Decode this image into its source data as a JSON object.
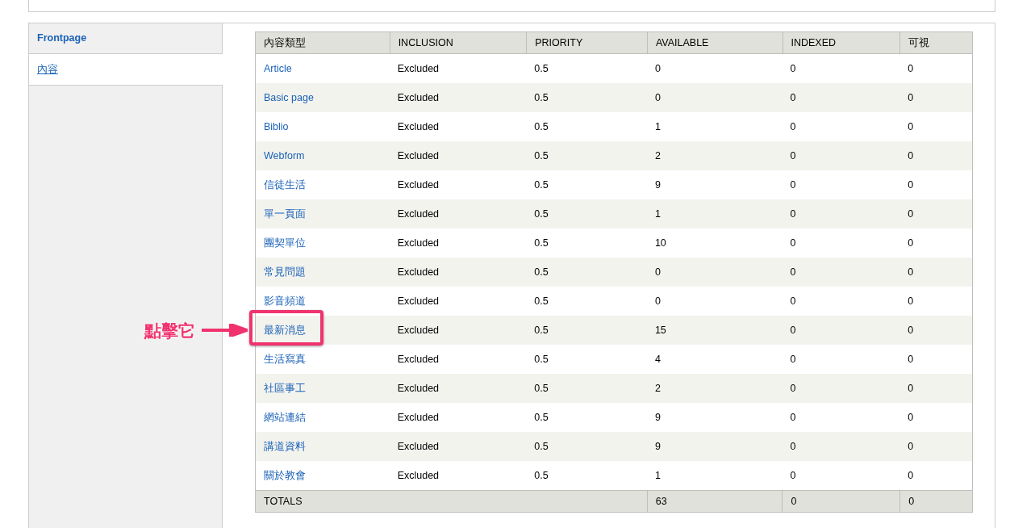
{
  "tabs": [
    {
      "label": "Frontpage",
      "selected": false
    },
    {
      "label": "內容",
      "selected": true
    }
  ],
  "table": {
    "columns": [
      "內容類型",
      "INCLUSION",
      "PRIORITY",
      "AVAILABLE",
      "INDEXED",
      "可視"
    ],
    "rows": [
      {
        "type": "Article",
        "inclusion": "Excluded",
        "priority": "0.5",
        "available": "0",
        "indexed": "0",
        "visible": "0",
        "highlighted": false
      },
      {
        "type": "Basic page",
        "inclusion": "Excluded",
        "priority": "0.5",
        "available": "0",
        "indexed": "0",
        "visible": "0",
        "highlighted": false
      },
      {
        "type": "Biblio",
        "inclusion": "Excluded",
        "priority": "0.5",
        "available": "1",
        "indexed": "0",
        "visible": "0",
        "highlighted": false
      },
      {
        "type": "Webform",
        "inclusion": "Excluded",
        "priority": "0.5",
        "available": "2",
        "indexed": "0",
        "visible": "0",
        "highlighted": false
      },
      {
        "type": "信徒生活",
        "inclusion": "Excluded",
        "priority": "0.5",
        "available": "9",
        "indexed": "0",
        "visible": "0",
        "highlighted": false
      },
      {
        "type": "單一頁面",
        "inclusion": "Excluded",
        "priority": "0.5",
        "available": "1",
        "indexed": "0",
        "visible": "0",
        "highlighted": false
      },
      {
        "type": "團契單位",
        "inclusion": "Excluded",
        "priority": "0.5",
        "available": "10",
        "indexed": "0",
        "visible": "0",
        "highlighted": false
      },
      {
        "type": "常見問題",
        "inclusion": "Excluded",
        "priority": "0.5",
        "available": "0",
        "indexed": "0",
        "visible": "0",
        "highlighted": false
      },
      {
        "type": "影音頻道",
        "inclusion": "Excluded",
        "priority": "0.5",
        "available": "0",
        "indexed": "0",
        "visible": "0",
        "highlighted": false
      },
      {
        "type": "最新消息",
        "inclusion": "Excluded",
        "priority": "0.5",
        "available": "15",
        "indexed": "0",
        "visible": "0",
        "highlighted": true
      },
      {
        "type": "生活寫真",
        "inclusion": "Excluded",
        "priority": "0.5",
        "available": "4",
        "indexed": "0",
        "visible": "0",
        "highlighted": false
      },
      {
        "type": "社區事工",
        "inclusion": "Excluded",
        "priority": "0.5",
        "available": "2",
        "indexed": "0",
        "visible": "0",
        "highlighted": false
      },
      {
        "type": "網站連結",
        "inclusion": "Excluded",
        "priority": "0.5",
        "available": "9",
        "indexed": "0",
        "visible": "0",
        "highlighted": false
      },
      {
        "type": "講道資料",
        "inclusion": "Excluded",
        "priority": "0.5",
        "available": "9",
        "indexed": "0",
        "visible": "0",
        "highlighted": false
      },
      {
        "type": "關於教會",
        "inclusion": "Excluded",
        "priority": "0.5",
        "available": "1",
        "indexed": "0",
        "visible": "0",
        "highlighted": false
      }
    ],
    "totals": {
      "label": "TOTALS",
      "available": "63",
      "indexed": "0",
      "visible": "0"
    }
  },
  "annotation": {
    "label": "點擊它"
  }
}
